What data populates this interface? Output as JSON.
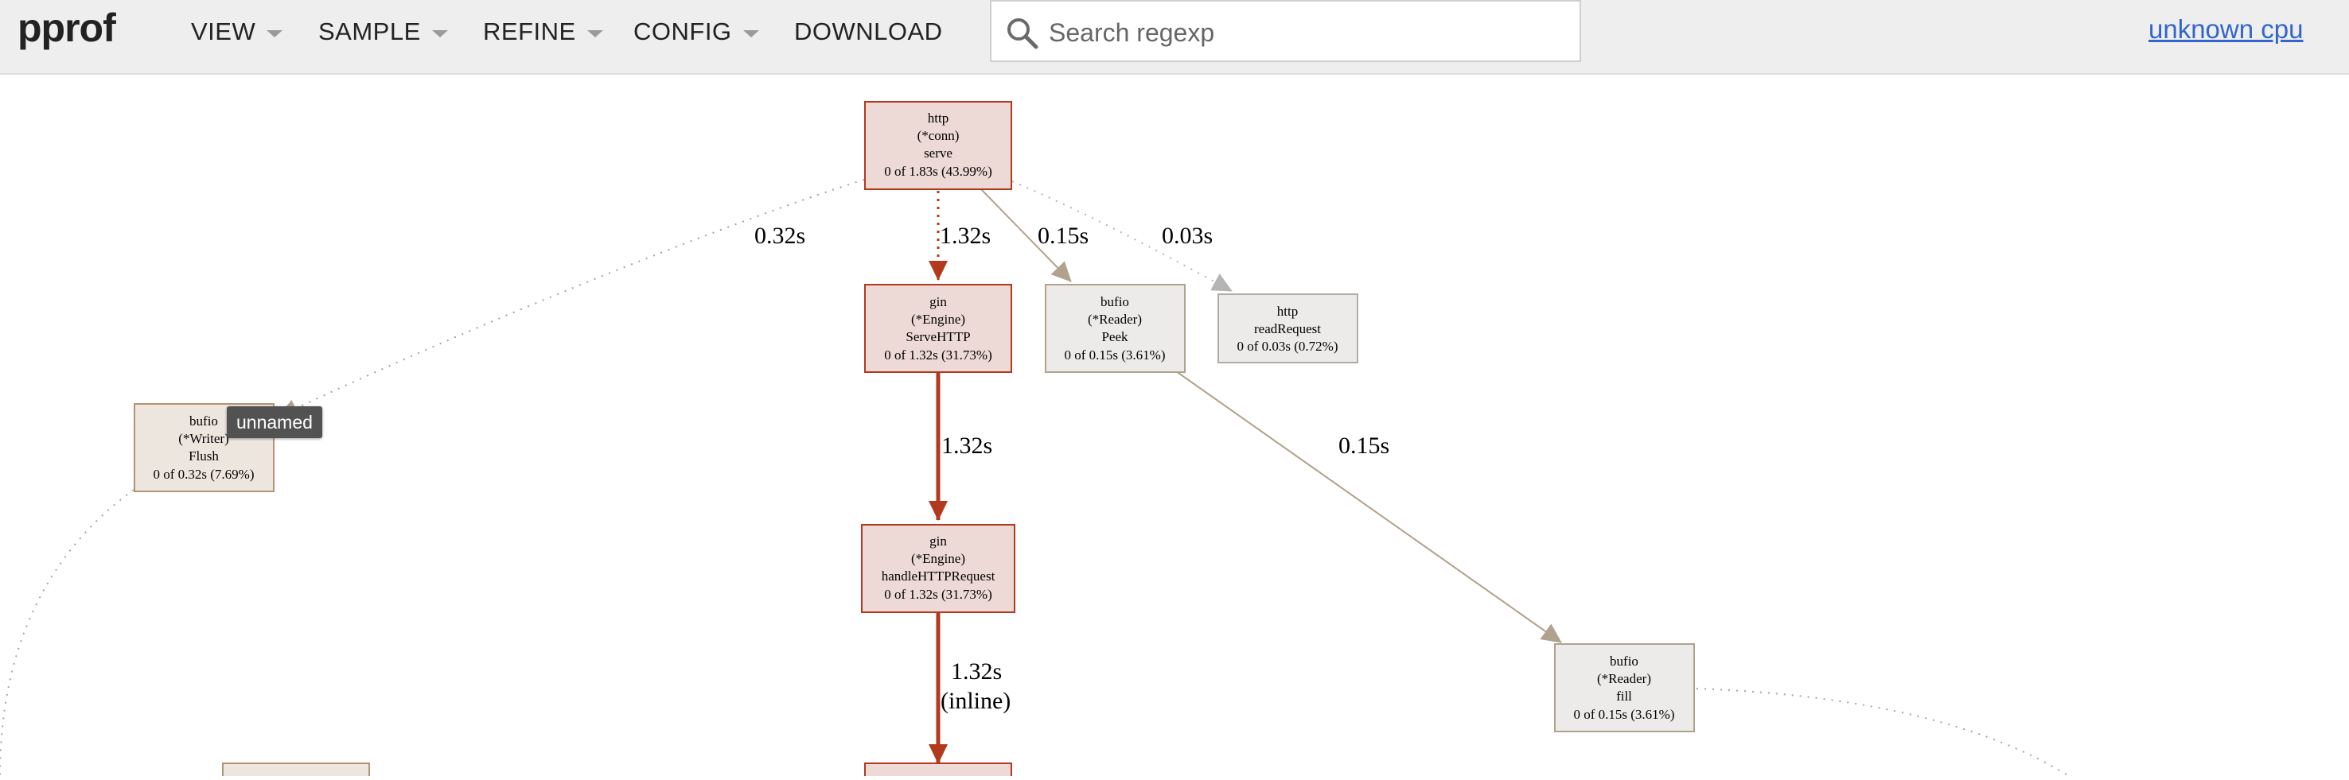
{
  "header": {
    "logo": "pprof",
    "menus": [
      {
        "label": "VIEW",
        "dropdown": true
      },
      {
        "label": "SAMPLE",
        "dropdown": true
      },
      {
        "label": "REFINE",
        "dropdown": true
      },
      {
        "label": "CONFIG",
        "dropdown": true
      },
      {
        "label": "DOWNLOAD",
        "dropdown": false
      }
    ],
    "search": {
      "placeholder": "Search regexp",
      "value": ""
    },
    "profile_link": "unknown cpu"
  },
  "tooltip": "unnamed",
  "graph": {
    "colors": {
      "hot_edge": "#b2391e",
      "warm_edge": "#b0a28c",
      "cold_edge": "#b4b4b4",
      "hot_fill": "#edd9d5",
      "hot_border": "#b2391e",
      "warm_fill": "#ede6df",
      "warm_border": "#b29474",
      "cold_fill": "#edebe9",
      "cold_border": "#b0aca6"
    },
    "nodes": [
      {
        "id": "http-conn-serve",
        "lines": [
          "http",
          "(*conn)",
          "serve",
          "0 of 1.83s (43.99%)"
        ]
      },
      {
        "id": "gin-engine-servehttp",
        "lines": [
          "gin",
          "(*Engine)",
          "ServeHTTP",
          "0 of 1.32s (31.73%)"
        ]
      },
      {
        "id": "bufio-reader-peek",
        "lines": [
          "bufio",
          "(*Reader)",
          "Peek",
          "0 of 0.15s (3.61%)"
        ]
      },
      {
        "id": "http-readrequest",
        "lines": [
          "http",
          "readRequest",
          "0 of 0.03s (0.72%)"
        ]
      },
      {
        "id": "bufio-writer-flush",
        "lines": [
          "bufio",
          "(*Writer)",
          "Flush",
          "0 of 0.32s (7.69%)"
        ]
      },
      {
        "id": "gin-engine-handlehttprequest",
        "lines": [
          "gin",
          "(*Engine)",
          "handleHTTPRequest",
          "0 of 1.32s (31.73%)"
        ]
      },
      {
        "id": "bufio-reader-fill",
        "lines": [
          "bufio",
          "(*Reader)",
          "fill",
          "0 of 0.15s (3.61%)"
        ]
      },
      {
        "id": "partial-node-left",
        "lines": []
      },
      {
        "id": "partial-node-center",
        "lines": []
      }
    ],
    "edges": [
      {
        "id": "serve-to-flush",
        "lines": [
          "0.32s"
        ]
      },
      {
        "id": "serve-to-servehttp",
        "lines": [
          "1.32s"
        ]
      },
      {
        "id": "serve-to-peek",
        "lines": [
          "0.15s"
        ]
      },
      {
        "id": "serve-to-readrequest",
        "lines": [
          "0.03s"
        ]
      },
      {
        "id": "servehttp-to-handlehttprequest",
        "lines": [
          "1.32s"
        ]
      },
      {
        "id": "peek-to-fill",
        "lines": [
          "0.15s"
        ]
      },
      {
        "id": "handlehttprequest-to-next",
        "lines": [
          "1.32s",
          "(inline)"
        ]
      }
    ]
  }
}
